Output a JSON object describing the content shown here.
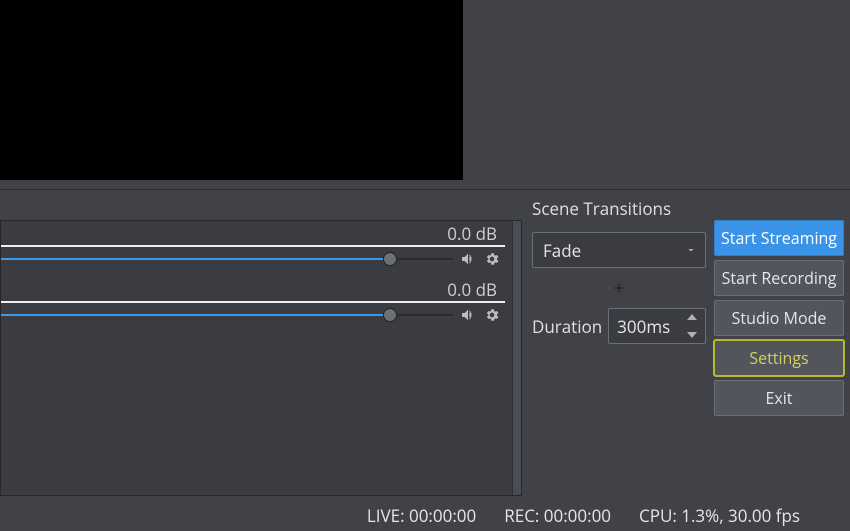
{
  "mixer": {
    "channels": [
      {
        "level_label": "0.0 dB",
        "slider_pct": 86,
        "meter_fill_pct": 86,
        "meter_white_pct": 12
      },
      {
        "level_label": "0.0 dB",
        "slider_pct": 86,
        "meter_fill_pct": 86,
        "meter_white_pct": 12
      }
    ]
  },
  "transitions": {
    "title": "Scene Transitions",
    "selected": "Fade",
    "duration_label": "Duration",
    "duration_value": "300ms"
  },
  "controls": {
    "start_streaming": "Start Streaming",
    "start_recording": "Start Recording",
    "studio_mode": "Studio Mode",
    "settings": "Settings",
    "exit": "Exit"
  },
  "status": {
    "live": "LIVE: 00:00:00",
    "rec": "REC: 00:00:00",
    "cpu": "CPU: 1.3%, 30.00 fps"
  }
}
